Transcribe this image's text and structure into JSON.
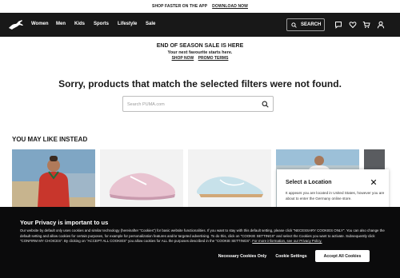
{
  "topbar": {
    "text": "SHOP FASTER ON THE APP",
    "link": "DOWNLOAD NOW"
  },
  "nav": {
    "items": [
      "Women",
      "Men",
      "Kids",
      "Sports",
      "Lifestyle",
      "Sale"
    ],
    "search_label": "SEARCH",
    "icons": [
      "chat-icon",
      "heart-icon",
      "cart-icon",
      "user-icon"
    ]
  },
  "promo": {
    "headline": "END OF SEASON SALE IS HERE",
    "subline": "Your next favourite starts here.",
    "links": [
      "SHOP NOW",
      "PROMO TERMS"
    ]
  },
  "no_results": "Sorry, products that match the selected filters were not found.",
  "search": {
    "placeholder": "Search PUMA.com"
  },
  "recommend": {
    "title": "YOU MAY LIKE INSTEAD"
  },
  "location_modal": {
    "title": "Select a Location",
    "body": "It appears you are located in United States, however you are about to enter the Germany online store."
  },
  "privacy": {
    "title": "Your Privacy is important to us",
    "body": "Our website by default only uses cookies and similar technology (hereinafter \"Cookies\") for basic website functionalities. If you want to stay with this default setting, please click \"NECESSARY COOKIES ONLY\". You can also change the default setting and allow cookies for certain purposes, for example for personalization features and/or targeted advertising. To do this, click on \"COOKIE SETTINGS\" and select the Cookies you want to activate. Subsequently click \"CONFIRM MY CHOICES\". By clicking on \"ACCEPT ALL COOKIES\" you allow cookies for ALL the purposes described in the \"COOKIE SETTINGS\".",
    "link": "For more information, see our Privacy Policy.",
    "buttons": {
      "necessary": "Necessary Cookies Only",
      "settings": "Cookie Settings",
      "accept": "Accept All Cookies"
    }
  },
  "colors": {
    "nav_bg": "#181818",
    "privacy_bg": "#0b0b0c",
    "text": "#191919"
  }
}
